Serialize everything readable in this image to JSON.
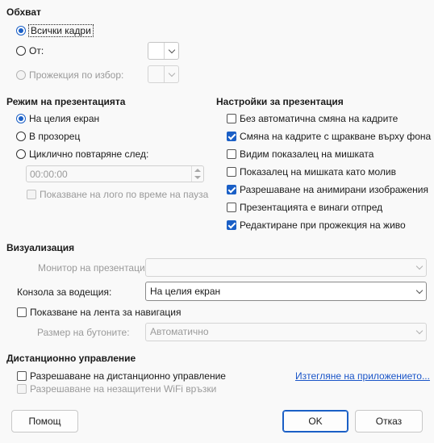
{
  "range": {
    "heading": "Обхват",
    "all_slides": "Всички кадри",
    "from": "От:",
    "custom": "Прожекция по избор:"
  },
  "mode": {
    "heading": "Режим на презентацията",
    "fullscreen": "На целия екран",
    "window": "В прозорец",
    "loop": "Циклично повтаряне след:",
    "loop_time": "00:00:00",
    "show_logo": "Показване на лого по време на пауза"
  },
  "settings": {
    "heading": "Настройки за презентация",
    "items": [
      {
        "label": "Без автоматична смяна на кадрите",
        "checked": false
      },
      {
        "label": "Смяна на кадрите с щракване върху фона",
        "checked": true
      },
      {
        "label": "Видим показалец на мишката",
        "checked": false
      },
      {
        "label": "Показалец на мишката като молив",
        "checked": false
      },
      {
        "label": "Разрешаване на анимирани изображения",
        "checked": true
      },
      {
        "label": "Презентацията е винаги отпред",
        "checked": false
      },
      {
        "label": "Редактиране при прожекция на живо",
        "checked": true
      }
    ]
  },
  "display": {
    "heading": "Визуализация",
    "monitor_label": "Монитор на презентацията",
    "monitor_value": "",
    "console_label": "Конзола за водещия:",
    "console_value": "На целия екран",
    "nav_bar": "Показване на лента за навигация",
    "button_size_label": "Размер на бутоните:",
    "button_size_value": "Автоматично"
  },
  "remote": {
    "heading": "Дистанционно управление",
    "enable": "Разрешаване на дистанционно управление",
    "insecure_wifi": "Разрешаване на незащитени WiFi връзки",
    "get_app": "Изтегляне на приложението..."
  },
  "buttons": {
    "help": "Помощ",
    "ok": "OK",
    "cancel": "Отказ"
  },
  "colors": {
    "accent": "#1a5fc6",
    "link": "#1a55c8"
  }
}
